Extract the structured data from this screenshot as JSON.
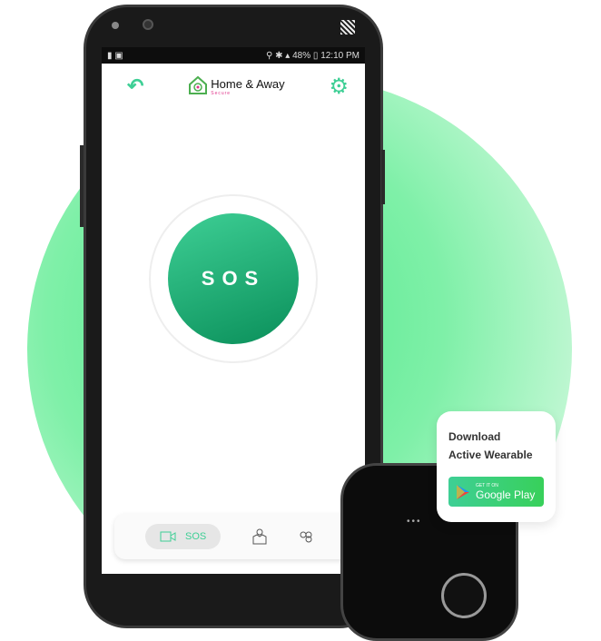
{
  "status_bar": {
    "battery": "48%",
    "time": "12:10 PM"
  },
  "app": {
    "title": "Home & Away",
    "subtitle": "Secure"
  },
  "sos_label": "SOS",
  "bottom_nav": {
    "items": [
      {
        "label": "SOS",
        "icon": "video-camera-icon",
        "active": true
      },
      {
        "icon": "map-pin-icon"
      },
      {
        "icon": "group-icon"
      }
    ]
  },
  "card": {
    "line1": "Download",
    "line2": "Active Wearable",
    "badge_small": "GET IT ON",
    "badge_large": "Google Play"
  },
  "colors": {
    "accent": "#3ecf95",
    "brand_pink": "#e0348a"
  }
}
